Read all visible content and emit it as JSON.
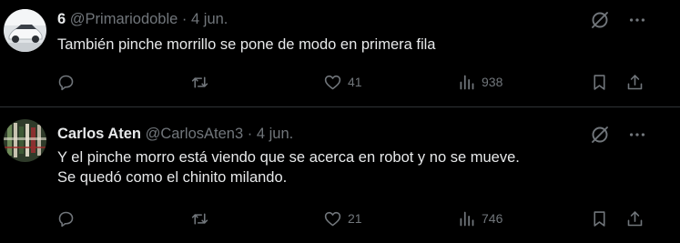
{
  "tweets": [
    {
      "display_name": "6",
      "handle": "@Primariodoble",
      "separator": "·",
      "date": "4 jun.",
      "text_lines": [
        "También pinche morrillo se pone de modo en primera fila"
      ],
      "replies": "",
      "retweets": "",
      "likes": "41",
      "views": "938"
    },
    {
      "display_name": "Carlos Aten",
      "handle": "@CarlosAten3",
      "separator": "·",
      "date": "4 jun.",
      "text_lines": [
        "Y el pinche morro está viendo que se acerca en robot y no se mueve.",
        "Se quedó como el chinito milando."
      ],
      "replies": "",
      "retweets": "",
      "likes": "21",
      "views": "746"
    }
  ],
  "icons": {
    "reply": "reply-icon",
    "retweet": "retweet-icon",
    "like": "heart-icon",
    "views": "views-chart-icon",
    "bookmark": "bookmark-icon",
    "share": "share-icon",
    "grok": "grok-icon",
    "more": "more-icon"
  },
  "colors": {
    "background": "#000000",
    "text_primary": "#e7e9ea",
    "text_secondary": "#71767b",
    "divider": "#2f3336"
  }
}
